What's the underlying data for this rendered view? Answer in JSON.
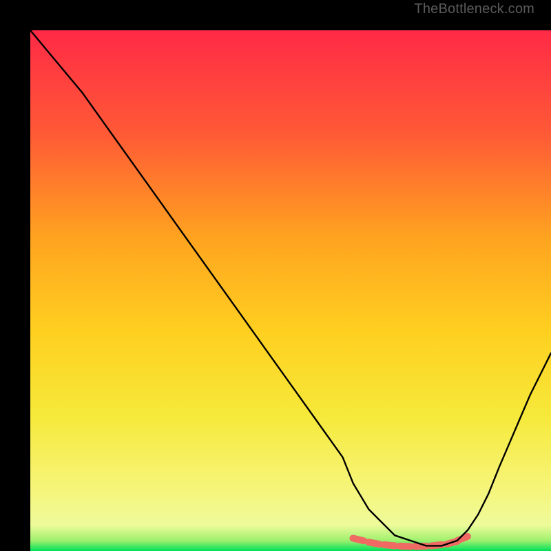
{
  "watermark": "TheBottleneck.com",
  "chart_data": {
    "type": "line",
    "title": "",
    "xlabel": "",
    "ylabel": "",
    "xlim": [
      0,
      100
    ],
    "ylim": [
      0,
      100
    ],
    "grid": false,
    "legend": false,
    "background_gradient": {
      "top": "#ff2a46",
      "upper_mid": "#ff7a2a",
      "mid": "#ffd020",
      "lower_mid": "#f6ee3a",
      "near_bottom": "#f7f97a",
      "bottom": "#00e05a"
    },
    "series": [
      {
        "name": "bottleneck-curve",
        "color": "#000000",
        "x": [
          0,
          5,
          10,
          15,
          20,
          25,
          30,
          35,
          40,
          45,
          50,
          55,
          60,
          62,
          65,
          68,
          70,
          73,
          76,
          79,
          82,
          84,
          86,
          88,
          90,
          93,
          96,
          100
        ],
        "values": [
          100,
          94,
          88,
          81,
          74,
          67,
          60,
          53,
          46,
          39,
          32,
          25,
          18,
          13,
          8,
          5,
          3,
          2,
          1,
          1,
          2,
          4,
          7,
          11,
          16,
          23,
          30,
          38
        ]
      }
    ],
    "markers": {
      "name": "optimal-band",
      "color": "#ef6a62",
      "shape": "rounded-segment",
      "points": [
        {
          "x": 63,
          "y": 2.2
        },
        {
          "x": 66,
          "y": 1.5
        },
        {
          "x": 69,
          "y": 1.1
        },
        {
          "x": 72,
          "y": 0.9
        },
        {
          "x": 75,
          "y": 0.9
        },
        {
          "x": 78,
          "y": 1.1
        },
        {
          "x": 81,
          "y": 1.6
        },
        {
          "x": 83,
          "y": 2.4
        }
      ]
    }
  }
}
